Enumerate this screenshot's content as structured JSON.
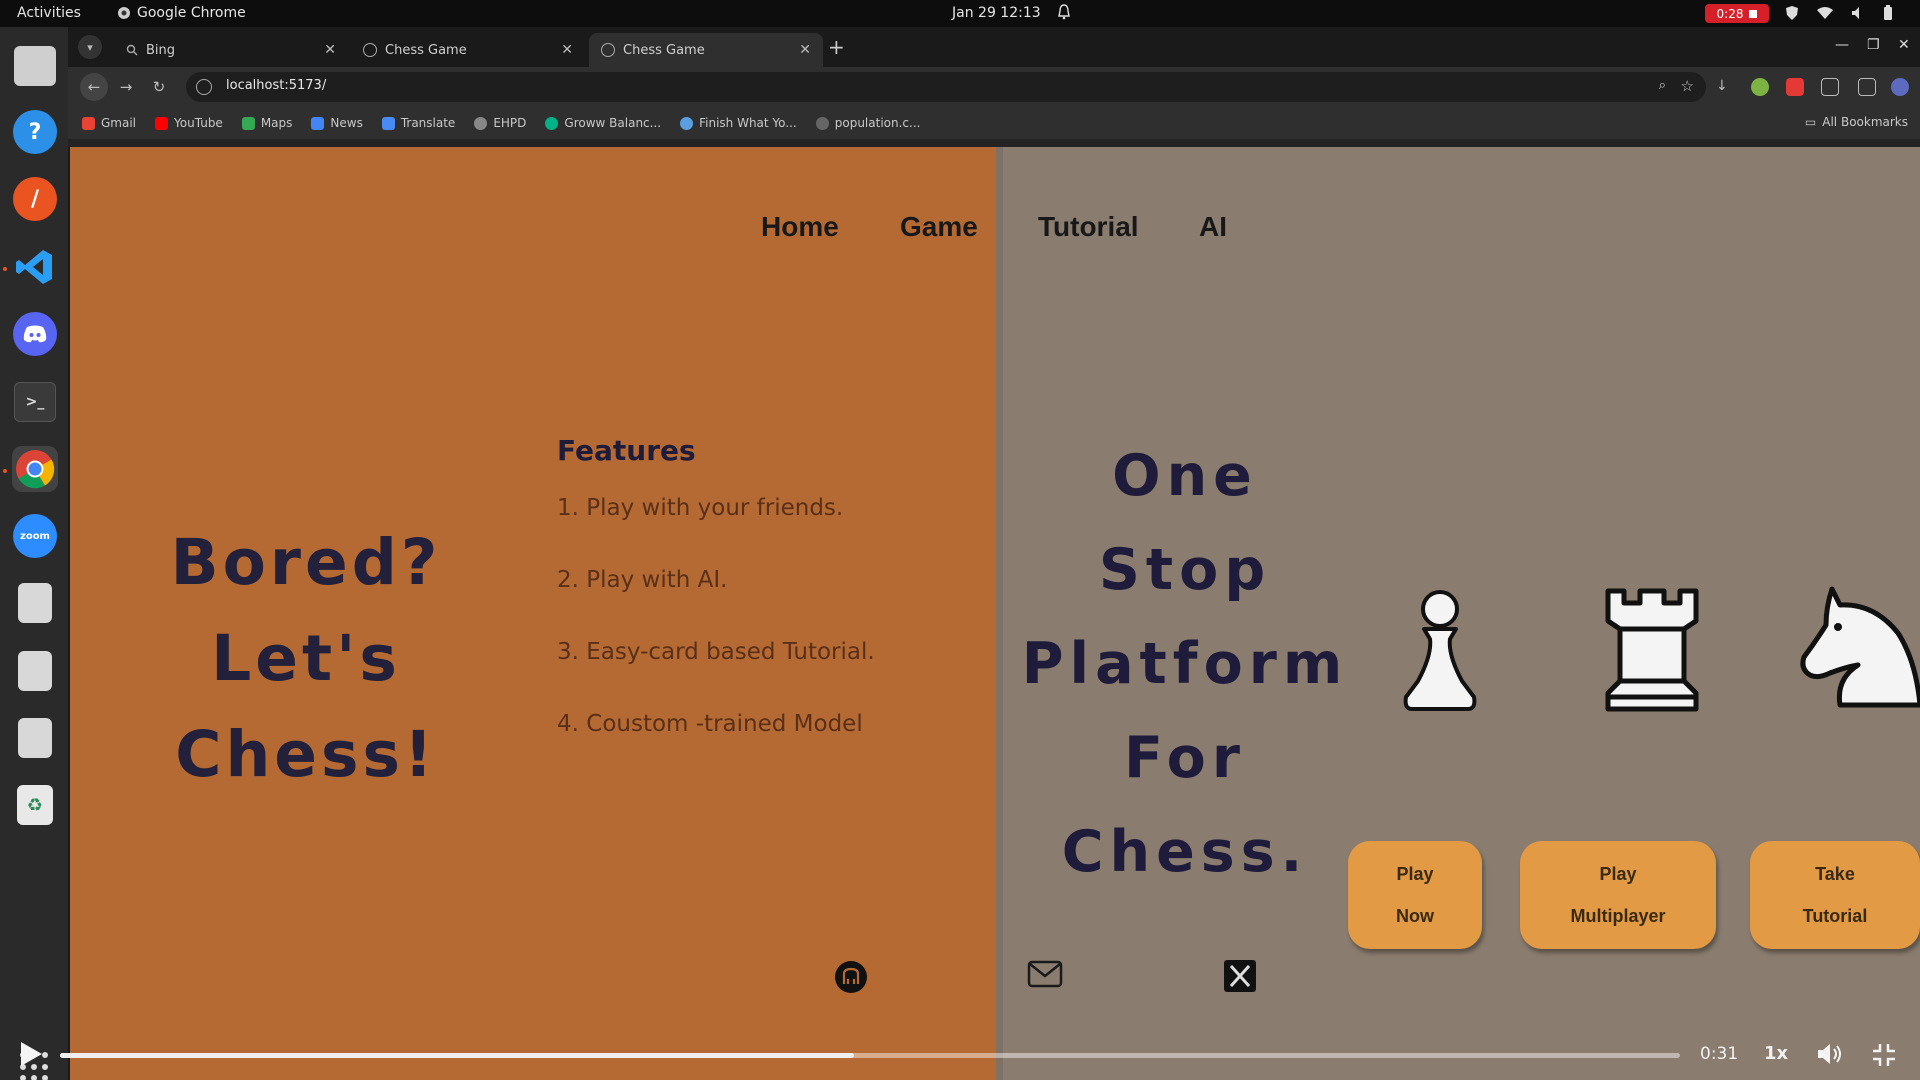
{
  "topbar": {
    "activities": "Activities",
    "app_name": "Google Chrome",
    "clock": "Jan 29  12:13",
    "recording_time": "0:28"
  },
  "dock": {
    "items": [
      "files-icon",
      "help-icon",
      "app-center-icon",
      "vscode-icon",
      "discord-icon",
      "terminal-icon",
      "chrome-icon",
      "zoom-icon",
      "drive-icon",
      "drive-icon",
      "drive-icon",
      "trash-icon"
    ]
  },
  "browser": {
    "tabs": [
      {
        "title": "Bing",
        "active": false
      },
      {
        "title": "Chess Game",
        "active": false
      },
      {
        "title": "Chess Game",
        "active": true
      }
    ],
    "url": "localhost:5173/",
    "bookmarks": [
      "Gmail",
      "YouTube",
      "Maps",
      "News",
      "Translate",
      "EHPD",
      "Groww Balanc...",
      "Finish What Yo...",
      "population.c..."
    ],
    "all_bookmarks": "All Bookmarks"
  },
  "page": {
    "nav": [
      "Home",
      "Game",
      "Tutorial",
      "AI"
    ],
    "hero_left": [
      "Bored?",
      "Let's Chess!"
    ],
    "features_title": "Features",
    "features": [
      "1. Play with your friends.",
      "2. Play with AI.",
      "3. Easy-card based Tutorial.",
      "4. Coustom -trained Model"
    ],
    "hero_right": [
      "One",
      "Stop",
      "Platform",
      "For",
      "Chess."
    ],
    "buttons": [
      {
        "line1": "Play",
        "line2": "Now"
      },
      {
        "line1": "Play",
        "line2": "Multiplayer"
      },
      {
        "line1": "Take",
        "line2": "Tutorial"
      }
    ],
    "pieces": [
      "pawn-icon",
      "rook-icon",
      "knight-icon"
    ],
    "colors": {
      "left_bg": "#b56a33",
      "right_bg": "#8a7d6f",
      "button": "#e29a45",
      "heading": "#1f1b3a"
    }
  },
  "video": {
    "time": "0:31",
    "speed": "1x",
    "progress": 0.49
  }
}
